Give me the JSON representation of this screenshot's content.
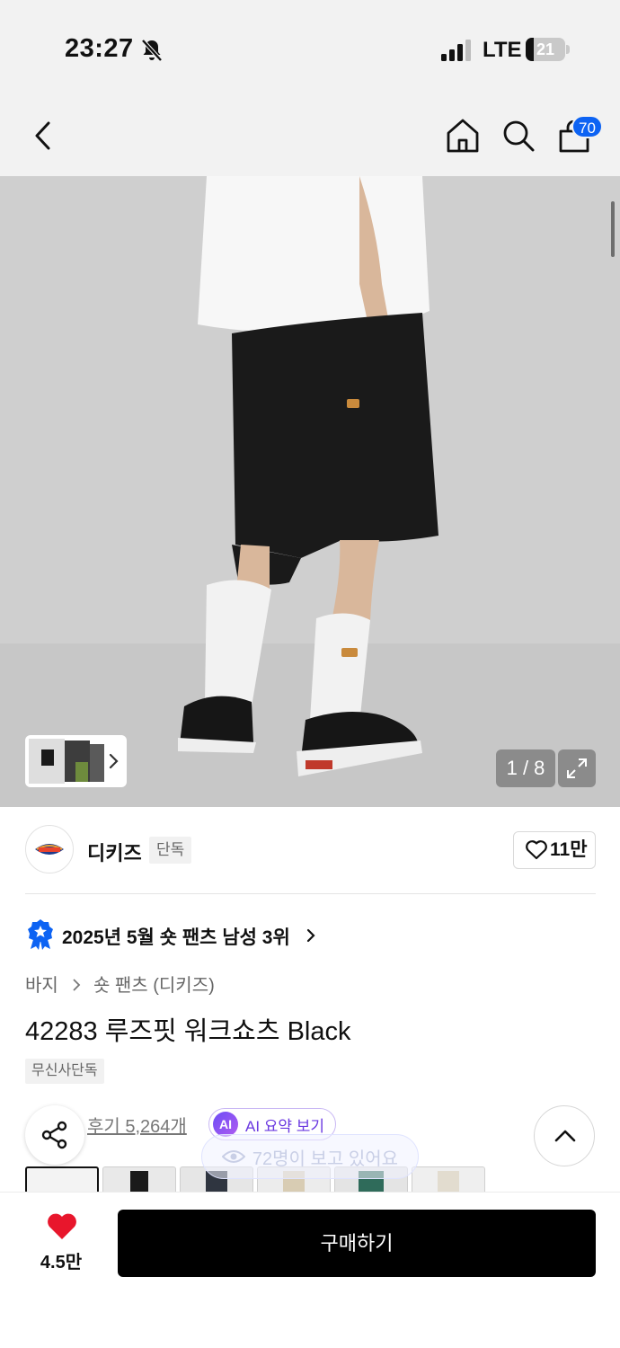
{
  "status_bar": {
    "time": "23:27",
    "network": "LTE",
    "battery": "21",
    "battery_level": 0.21,
    "icons": [
      "bell-slash-icon",
      "signal-bars-icon",
      "battery-icon"
    ]
  },
  "nav": {
    "icons": [
      "back-chevron-icon",
      "home-icon",
      "search-icon",
      "cart-icon"
    ],
    "cart_count": "70"
  },
  "gallery": {
    "counter": "1 / 8",
    "icons": [
      "expand-icon",
      "chevron-right-icon"
    ]
  },
  "brand": {
    "name": "디키즈",
    "tag": "단독",
    "likes": "11만",
    "logo_text": "Dickies"
  },
  "ranking": {
    "text": "2025년 5월 숏 팬츠 남성 3위"
  },
  "breadcrumb": {
    "items": [
      "바지",
      "숏 팬츠 (디키즈)"
    ]
  },
  "product": {
    "title": "42283 루즈핏 워크쇼츠 Black",
    "tag": "무신사단독"
  },
  "reviews": {
    "link": "후기 5,264개",
    "ai_badge": "AI",
    "ai_label": "AI 요약 보기"
  },
  "viewers": {
    "text": "72명이 보고 있어요"
  },
  "bottom_bar": {
    "wish_count": "4.5만",
    "buy_label": "구매하기"
  },
  "colors": {
    "accent": "#0d63f3",
    "heart": "#e8162c",
    "ai": "#6a38e0",
    "buy_button": "#000000"
  }
}
